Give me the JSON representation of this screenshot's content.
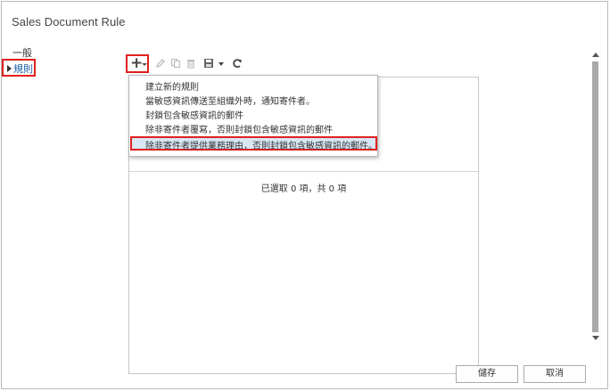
{
  "window": {
    "title": "Sales Document Rule"
  },
  "nav": {
    "items": [
      {
        "label": "一般"
      },
      {
        "label": "規則"
      }
    ]
  },
  "toolbar": {
    "icons": [
      "add-icon",
      "chevron-down-icon",
      "edit-icon",
      "copy-icon",
      "delete-icon",
      "save-icon",
      "chevron-down-icon",
      "refresh-icon"
    ]
  },
  "menu": {
    "items": [
      {
        "label": "建立新的規則"
      },
      {
        "label": "當敏感資訊傳送至組織外時，通知寄件者。"
      },
      {
        "label": "封鎖包含敏感資訊的郵件"
      },
      {
        "label": "除非寄件者覆寫，否則封鎖包含敏感資訊的郵件"
      },
      {
        "label": "除非寄件者提供業務理由，否則封鎖包含敏感資訊的郵件。"
      }
    ],
    "selected_index": 4
  },
  "list": {
    "status": "已選取 0 項，共 0 項"
  },
  "footer": {
    "save_label": "儲存",
    "cancel_label": "取消"
  },
  "colors": {
    "highlight_border": "#e02020",
    "link": "#1e5fa8",
    "selection_bg": "#d9e7f5"
  }
}
